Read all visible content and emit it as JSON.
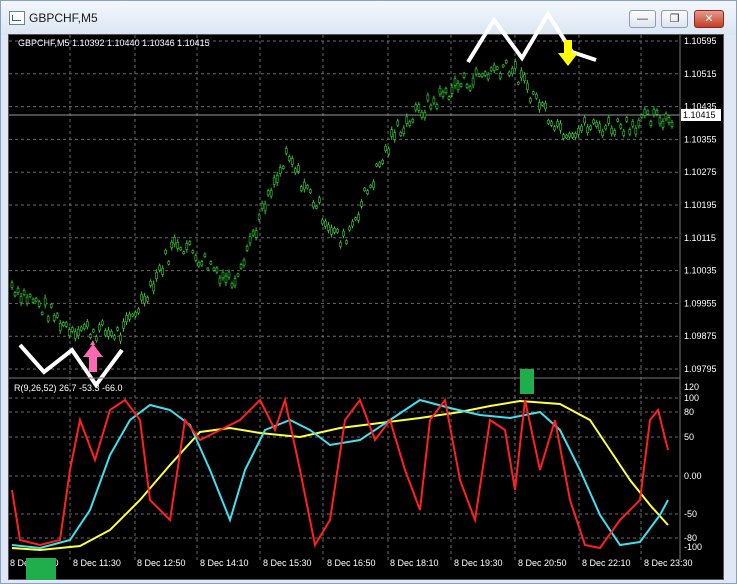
{
  "window": {
    "title": "GBPCHF,M5",
    "min_glyph": "—",
    "max_glyph": "❐",
    "close_glyph": "✕"
  },
  "chart_header": {
    "text": "GBPCHF,M5  1.10392 1.10440 1.10346 1.10415"
  },
  "price_axis": {
    "labels": [
      "1.10595",
      "1.10515",
      "1.10435",
      "1.10355",
      "1.10275",
      "1.10195",
      "1.10115",
      "1.10035",
      "1.09955",
      "1.09875",
      "1.09795"
    ],
    "current": "1.10415"
  },
  "indicator": {
    "text": "R(9,26,52) 26.7 -53.3 -66.0",
    "axis_labels": [
      "120",
      "100",
      "80",
      "50",
      "0.00",
      "-50",
      "-80",
      "-100"
    ]
  },
  "time_axis": {
    "labels": [
      "8 Dec 10:20",
      "8 Dec 11:30",
      "8 Dec 12:50",
      "8 Dec 14:10",
      "8 Dec 15:30",
      "8 Dec 16:50",
      "8 Dec 18:10",
      "8 Dec 19:30",
      "8 Dec 20:50",
      "8 Dec 22:10",
      "8 Dec 23:30"
    ]
  },
  "colors": {
    "candle": "#32cd32",
    "red_line": "#ff2020",
    "cyan_line": "#40e0f0",
    "yellow_line": "#ffff40",
    "buy_arrow": "#ff69b4",
    "sell_arrow": "#ffff00",
    "marker": "#1fae4b"
  },
  "icons": [
    "pink-up-arrow-icon",
    "yellow-down-arrow-icon"
  ],
  "chart_data": {
    "type": "line",
    "title": "GBPCHF,M5",
    "x": [
      "8 Dec 10:20",
      "8 Dec 11:30",
      "8 Dec 12:50",
      "8 Dec 14:10",
      "8 Dec 15:30",
      "8 Dec 16:50",
      "8 Dec 18:10",
      "8 Dec 19:30",
      "8 Dec 20:50",
      "8 Dec 22:10",
      "8 Dec 23:30"
    ],
    "ylim": [
      1.09795,
      1.10595
    ],
    "series": [
      {
        "values": [
          1.1,
          1.099,
          1.0988,
          1.1011,
          1.1001,
          1.1031,
          1.101,
          1.1038,
          1.1048,
          1.1054,
          1.1038,
          1.1039,
          1.1041
        ]
      }
    ]
  }
}
